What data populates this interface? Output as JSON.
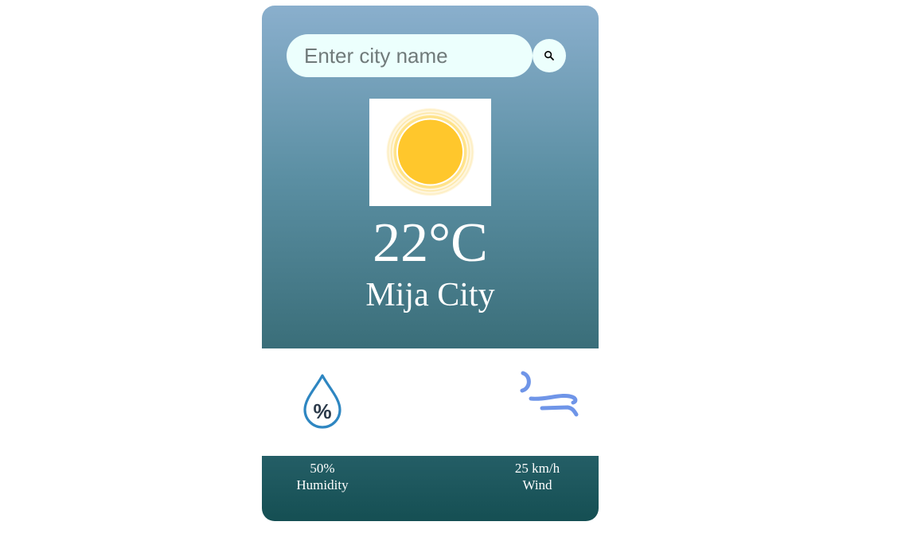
{
  "search": {
    "placeholder": "Enter city name",
    "value": ""
  },
  "weather": {
    "icon": "sun-icon",
    "temperature": "22°C",
    "city": "Mija City"
  },
  "details": {
    "humidity": {
      "icon": "humidity-icon",
      "value": "50%",
      "label": "Humidity"
    },
    "wind": {
      "icon": "wind-icon",
      "value": "25 km/h",
      "label": "Wind"
    }
  },
  "colors": {
    "gradient_top": "#8aafcd",
    "gradient_bottom": "#3a6e79",
    "footer": "#1b555b",
    "search_bg": "#ecfffd",
    "sun": "#ffc72c",
    "humidity_icon": "#2e86c1",
    "wind_icon": "#6f95e8"
  }
}
